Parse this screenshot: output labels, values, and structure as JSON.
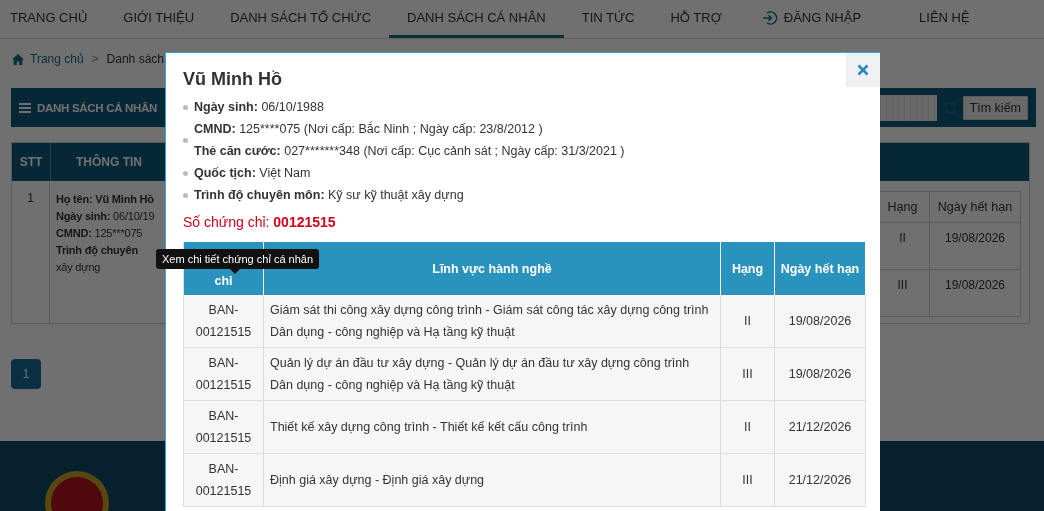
{
  "nav": {
    "items": [
      {
        "label": "TRANG CHỦ",
        "selected": false,
        "kind": "link"
      },
      {
        "label": "GIỚI THIỆU",
        "selected": false,
        "kind": "link"
      },
      {
        "label": "DANH SÁCH TỔ CHỨC",
        "selected": false,
        "kind": "link"
      },
      {
        "label": "DANH SÁCH CÁ NHÂN",
        "selected": true,
        "kind": "link"
      },
      {
        "label": "TIN TỨC",
        "selected": false,
        "kind": "link"
      },
      {
        "label": "HỖ TRỢ",
        "selected": false,
        "kind": "link"
      },
      {
        "label": "ĐĂNG NHẬP",
        "selected": false,
        "kind": "login"
      },
      {
        "label": "LIÊN HỆ",
        "selected": false,
        "kind": "link"
      }
    ]
  },
  "breadcrumb": {
    "home": "Trang chủ",
    "separator": ">",
    "current": "Danh sách"
  },
  "panel": {
    "title": "DANH SÁCH CÁ NHÂN",
    "search_button": "Tìm kiếm"
  },
  "list_table": {
    "columns": [
      "STT",
      "THÔNG TIN"
    ],
    "rows": [
      {
        "stt": "1",
        "lines": [
          {
            "label": "Họ tên: Vũ Minh Hồ"
          },
          {
            "label": "Ngày sinh:",
            "value": "06/10/19"
          },
          {
            "label": "CMND:",
            "value": "125***075"
          },
          {
            "label": "Trình độ chuyên"
          },
          {
            "value": "xây dựng"
          }
        ],
        "cert_columns": [
          "Hạng",
          "Ngày hết hạn"
        ],
        "certs": [
          {
            "rank": "II",
            "expiry": "19/08/2026"
          },
          {
            "rank": "III",
            "expiry": "19/08/2026"
          }
        ]
      }
    ]
  },
  "pagination": [
    {
      "label": "1",
      "selected": true
    }
  ],
  "modal": {
    "name": "Vũ Minh Hồ",
    "details": [
      {
        "items": [
          {
            "label": "Ngày sinh:",
            "value": "06/10/1988"
          }
        ]
      },
      {
        "items": [
          {
            "label": "CMND:",
            "value": "125****075 (Nơi cấp: Bắc Ninh ; Ngày cấp: 23/8/2012 )"
          },
          {
            "label": "Thẻ căn cước:",
            "value": "027*******348 (Nơi cấp: Cục cảnh sát ; Ngày cấp: 31/3/2021 )"
          }
        ]
      },
      {
        "items": [
          {
            "label": "Quốc tịch:",
            "value": "Việt Nam"
          }
        ]
      },
      {
        "items": [
          {
            "label": "Trình độ chuyên môn:",
            "value": "Kỹ sư kỹ thuật xây dựng"
          }
        ]
      }
    ],
    "certificate": {
      "label": "Số chứng chỉ:",
      "value": "00121515"
    },
    "tooltip": "Xem chi tiết chứng chỉ cá nhân",
    "columns": [
      "chỉ",
      "Lĩnh vực hành nghề",
      "Hạng",
      "Ngày hết hạn"
    ],
    "rows": [
      {
        "code": "BAN-00121515",
        "field": "Giám sát thi công xây dựng công trình - Giám sát công tác xây dựng công trình Dân dụng - công nghiệp và Hạ tầng kỹ thuật",
        "rank": "II",
        "expiry": "19/08/2026"
      },
      {
        "code": "BAN-00121515",
        "field": "Quản lý dự án đầu tư xây dựng - Quản lý dự án đầu tư xây dựng công trình Dân dụng - công nghiệp và Hạ tầng kỹ thuật",
        "rank": "III",
        "expiry": "19/08/2026"
      },
      {
        "code": "BAN-00121515",
        "field": "Thiết kế xây dựng công trình - Thiết kế kết cấu công trình",
        "rank": "II",
        "expiry": "21/12/2026"
      },
      {
        "code": "BAN-00121515",
        "field": "Định giá xây dựng - Định giá xây dựng",
        "rank": "III",
        "expiry": "21/12/2026"
      }
    ]
  }
}
